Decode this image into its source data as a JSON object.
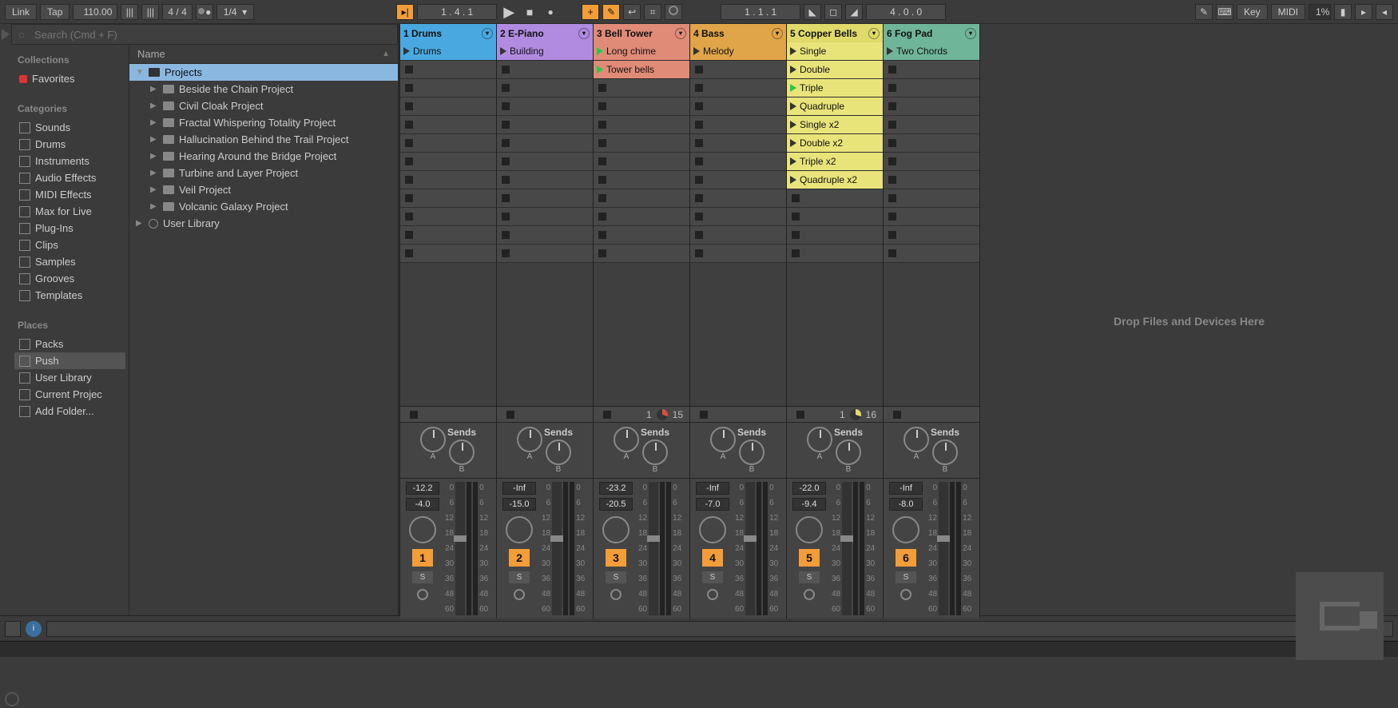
{
  "topbar": {
    "link": "Link",
    "tap": "Tap",
    "tempo": "110.00",
    "sig_num": "4",
    "sig_den": "4",
    "quant": "1/4",
    "position": "1 .   4 .   1",
    "loop_pos": "1 .   1 .   1",
    "loop_len": "4 .   0 .   0"
  },
  "browser": {
    "search_placeholder": "Search (Cmd + F)",
    "collections_hdr": "Collections",
    "favorites": "Favorites",
    "categories_hdr": "Categories",
    "categories": [
      "Sounds",
      "Drums",
      "Instruments",
      "Audio Effects",
      "MIDI Effects",
      "Max for Live",
      "Plug-Ins",
      "Clips",
      "Samples",
      "Grooves",
      "Templates"
    ],
    "places_hdr": "Places",
    "places": [
      "Packs",
      "Push",
      "User Library",
      "Current Projec",
      "Add Folder..."
    ],
    "name_hdr": "Name",
    "tree_root": "Projects",
    "projects": [
      "Beside the Chain Project",
      "Civil Cloak Project",
      "Fractal Whispering Totality Project",
      "Hallucination Behind the Trail Project",
      "Hearing Around the Bridge Project",
      "Turbine and Layer Project",
      "Veil Project",
      "Volcanic Galaxy Project"
    ],
    "user_library": "User Library"
  },
  "drop_hint": "Drop Files and Devices Here",
  "tracks": [
    {
      "name": "1 Drums",
      "color": "#4aa8e0",
      "clips": [
        {
          "name": "Drums",
          "color": "#4aa8e0",
          "play": "dark"
        }
      ],
      "status": {},
      "vol": "-12.2",
      "gain": "-4.0",
      "num": "1"
    },
    {
      "name": "2 E-Piano",
      "color": "#b18be0",
      "clips": [
        {
          "name": "Building",
          "color": "#b18be0",
          "play": "dark"
        }
      ],
      "status": {},
      "vol": "-Inf",
      "gain": "-15.0",
      "num": "2"
    },
    {
      "name": "3 Bell Tower",
      "color": "#e08b77",
      "clips": [
        {
          "name": "Long chime",
          "color": "#e08b77",
          "play": "green"
        },
        {
          "name": "Tower bells",
          "color": "#e08b77",
          "play": "green"
        }
      ],
      "status": {
        "beat": "1",
        "pie": "#d94f3d",
        "len": "15"
      },
      "vol": "-23.2",
      "gain": "-20.5",
      "num": "3"
    },
    {
      "name": "4 Bass",
      "color": "#e0a548",
      "clips": [
        {
          "name": "Melody",
          "color": "#e0a548",
          "play": "dark"
        }
      ],
      "status": {},
      "vol": "-Inf",
      "gain": "-7.0",
      "num": "4"
    },
    {
      "name": "5 Copper Bells",
      "color": "#e0da6a",
      "clips": [
        {
          "name": "Single",
          "color": "#e9e47a",
          "play": "dark"
        },
        {
          "name": "Double",
          "color": "#e9e47a",
          "play": "dark"
        },
        {
          "name": "Triple",
          "color": "#e9e47a",
          "play": "green"
        },
        {
          "name": "Quadruple",
          "color": "#e9e47a",
          "play": "dark"
        },
        {
          "name": "Single x2",
          "color": "#e9e47a",
          "play": "dark"
        },
        {
          "name": "Double x2",
          "color": "#e9e47a",
          "play": "dark"
        },
        {
          "name": "Triple x2",
          "color": "#e9e47a",
          "play": "dark"
        },
        {
          "name": "Quadruple x2",
          "color": "#e9e47a",
          "play": "dark"
        }
      ],
      "status": {
        "beat": "1",
        "pie": "#e0da6a",
        "len": "16"
      },
      "vol": "-22.0",
      "gain": "-9.4",
      "num": "5"
    },
    {
      "name": "6 Fog Pad",
      "color": "#6fb59a",
      "clips": [
        {
          "name": "Two  Chords",
          "color": "#6fb59a",
          "play": "dark"
        }
      ],
      "status": {},
      "vol": "-Inf",
      "gain": "-8.0",
      "num": "6"
    }
  ],
  "scale_left": [
    "0",
    "6",
    "12",
    "18",
    "24",
    "30",
    "36",
    "48",
    "60"
  ],
  "scale_right": [
    "0",
    "6",
    "12",
    "18",
    "24",
    "30",
    "36",
    "48",
    "60"
  ],
  "sends_label": "Sends",
  "send_a": "A",
  "send_b": "B",
  "solo": "S",
  "slot_rows": 12
}
